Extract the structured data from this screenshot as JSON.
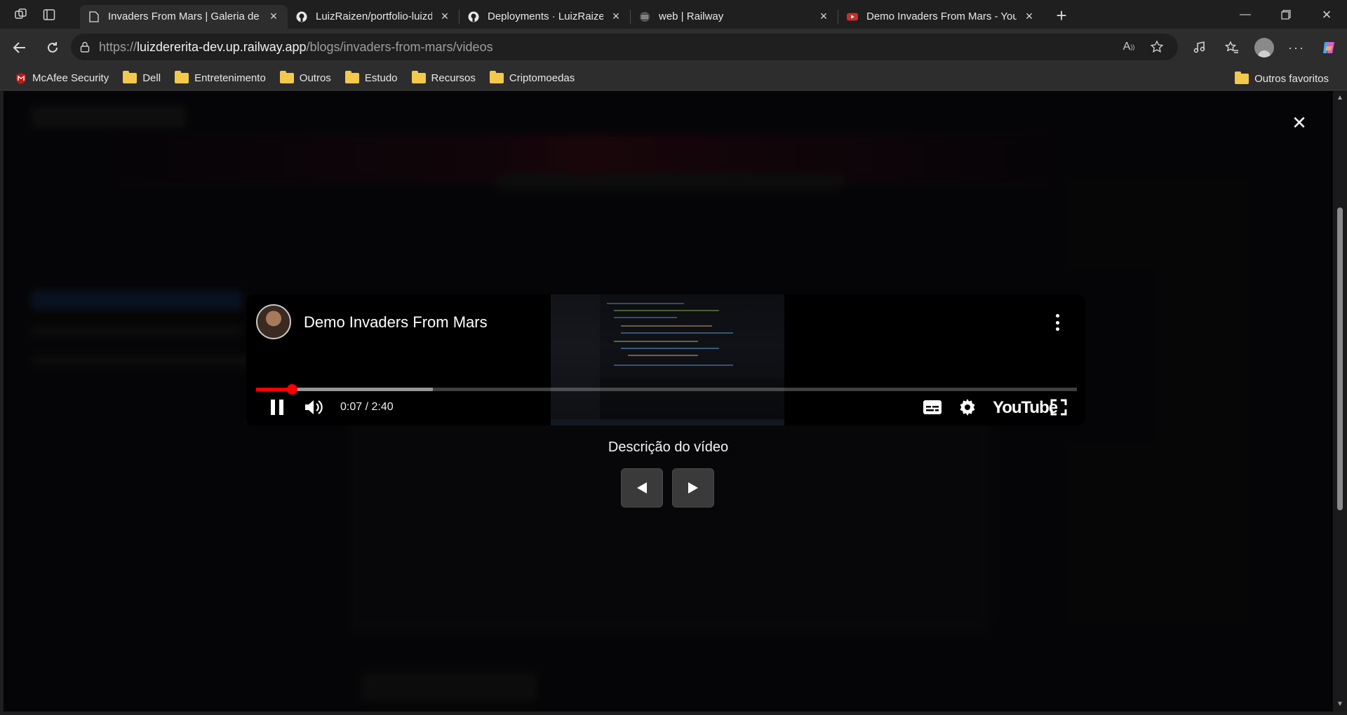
{
  "tabs": [
    {
      "title": "Invaders From Mars | Galeria de V",
      "active": true,
      "favicon": "page-icon"
    },
    {
      "title": "LuizRaizen/portfolio-luizdererita-",
      "active": false,
      "favicon": "github-icon"
    },
    {
      "title": "Deployments · LuizRaizen/portfoli",
      "active": false,
      "favicon": "github-icon"
    },
    {
      "title": "web | Railway",
      "active": false,
      "favicon": "railway-icon"
    },
    {
      "title": "Demo Invaders From Mars - YouT",
      "active": false,
      "favicon": "youtube-icon"
    }
  ],
  "address": {
    "url_prefix": "https://",
    "url_host": "luizdererita-dev.up.railway.app",
    "url_path": "/blogs/invaders-from-mars/videos"
  },
  "bookmarks": {
    "items": [
      {
        "label": "McAfee Security",
        "icon": "mcafee-icon"
      },
      {
        "label": "Dell",
        "icon": "folder-icon"
      },
      {
        "label": "Entretenimento",
        "icon": "folder-icon"
      },
      {
        "label": "Outros",
        "icon": "folder-icon"
      },
      {
        "label": "Estudo",
        "icon": "folder-icon"
      },
      {
        "label": "Recursos",
        "icon": "folder-icon"
      },
      {
        "label": "Criptomoedas",
        "icon": "folder-icon"
      }
    ],
    "other_favorites": "Outros favoritos"
  },
  "player": {
    "title": "Demo Invaders From Mars",
    "time": "0:07 / 2:40",
    "progress_fraction": 0.044,
    "buffer_fraction": 0.215,
    "brand": "YouTube"
  },
  "modal": {
    "description_label": "Descrição do vídeo"
  },
  "colors": {
    "progress_played": "#ff0000",
    "accent": "#ff0000"
  }
}
